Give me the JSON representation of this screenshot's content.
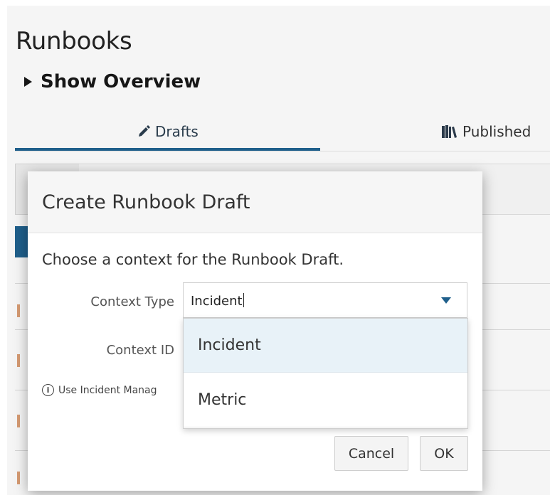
{
  "page": {
    "title": "Runbooks",
    "overview_toggle": "Show Overview"
  },
  "tabs": [
    {
      "label": "Drafts",
      "icon": "pencil-icon",
      "selected": true
    },
    {
      "label": "Published",
      "icon": "books-icon",
      "selected": false
    }
  ],
  "dialog": {
    "title": "Create Runbook Draft",
    "instructions": "Choose a context for the Runbook Draft.",
    "context_type": {
      "label": "Context Type",
      "value": "Incident",
      "options": [
        "Incident",
        "Metric"
      ],
      "highlighted": "Incident"
    },
    "context_id": {
      "label": "Context ID"
    },
    "hint": "Use Incident Manag",
    "buttons": {
      "cancel": "Cancel",
      "ok": "OK"
    }
  },
  "colors": {
    "accent": "#1f5f8b",
    "highlight": "#e8f2f8"
  }
}
